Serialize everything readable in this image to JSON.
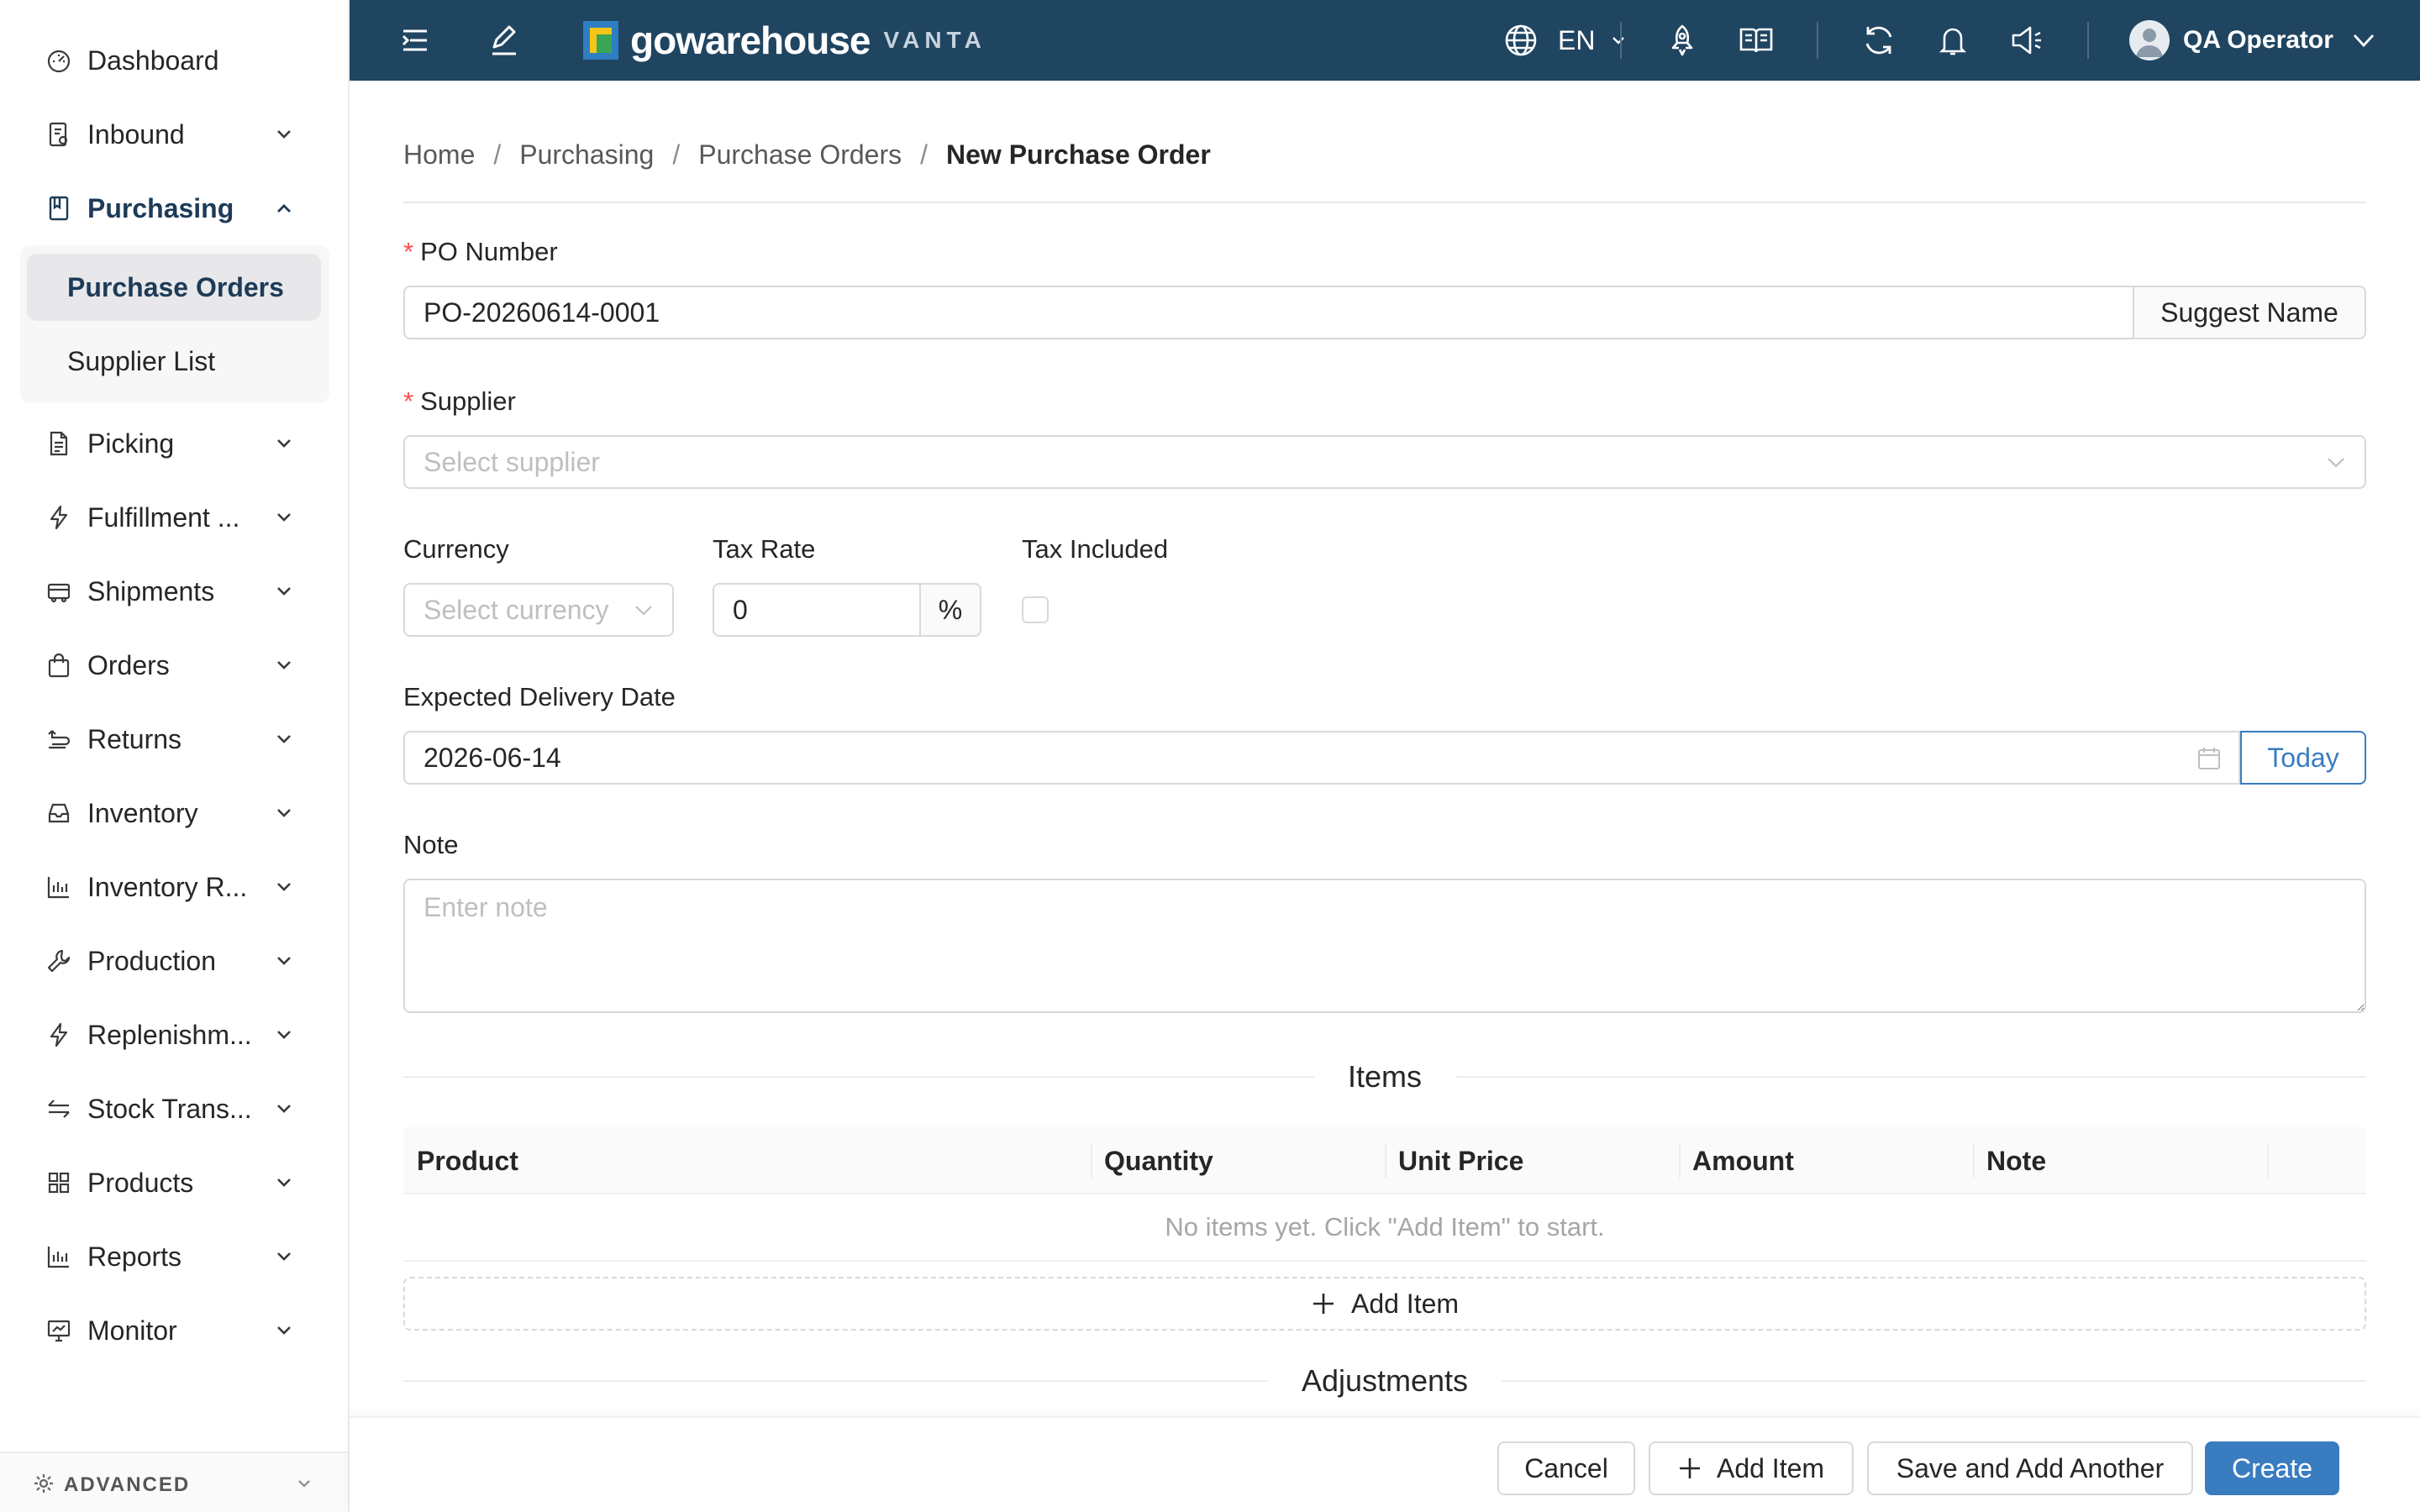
{
  "sidebar": {
    "items": [
      {
        "label": "Dashboard",
        "icon": "dashboard-icon"
      },
      {
        "label": "Inbound",
        "icon": "inbound-icon"
      },
      {
        "label": "Purchasing",
        "icon": "purchasing-icon"
      },
      {
        "label": "Picking",
        "icon": "picking-icon"
      },
      {
        "label": "Fulfillment ...",
        "icon": "fulfillment-icon"
      },
      {
        "label": "Shipments",
        "icon": "shipments-icon"
      },
      {
        "label": "Orders",
        "icon": "orders-icon"
      },
      {
        "label": "Returns",
        "icon": "returns-icon"
      },
      {
        "label": "Inventory",
        "icon": "inventory-icon"
      },
      {
        "label": "Inventory R...",
        "icon": "inventory-reports-icon"
      },
      {
        "label": "Production",
        "icon": "production-icon"
      },
      {
        "label": "Replenishm...",
        "icon": "replenishment-icon"
      },
      {
        "label": "Stock Trans...",
        "icon": "stock-transfer-icon"
      },
      {
        "label": "Products",
        "icon": "products-icon"
      },
      {
        "label": "Reports",
        "icon": "reports-icon"
      },
      {
        "label": "Monitor",
        "icon": "monitor-icon"
      }
    ],
    "submenu": [
      {
        "label": "Purchase Orders"
      },
      {
        "label": "Supplier List"
      }
    ],
    "advanced_label": "ADVANCED"
  },
  "header": {
    "logo_text": "gowarehouse",
    "logo_sub": "VANTA",
    "language": "EN",
    "user_name": "QA Operator"
  },
  "breadcrumb": {
    "items": [
      "Home",
      "Purchasing",
      "Purchase Orders"
    ],
    "current": "New Purchase Order",
    "separator": "/"
  },
  "form": {
    "po_number": {
      "label": "PO Number",
      "value": "PO-20260614-0001",
      "suggest_label": "Suggest Name"
    },
    "supplier": {
      "label": "Supplier",
      "placeholder": "Select supplier"
    },
    "currency": {
      "label": "Currency",
      "placeholder": "Select currency"
    },
    "tax_rate": {
      "label": "Tax Rate",
      "value": "0",
      "suffix": "%"
    },
    "tax_included": {
      "label": "Tax Included",
      "checked": false
    },
    "expected_delivery": {
      "label": "Expected Delivery Date",
      "value": "2026-06-14",
      "today_label": "Today"
    },
    "note": {
      "label": "Note",
      "placeholder": "Enter note"
    }
  },
  "items_section": {
    "title": "Items",
    "columns": [
      "Product",
      "Quantity",
      "Unit Price",
      "Amount",
      "Note"
    ],
    "empty_text": "No items yet. Click \"Add Item\" to start.",
    "add_item_label": "Add Item"
  },
  "adjustments_section": {
    "title": "Adjustments"
  },
  "footer": {
    "cancel": "Cancel",
    "add_item": "Add Item",
    "save_add_another": "Save and Add Another",
    "create": "Create"
  },
  "colors": {
    "header_bg": "#1f4561",
    "primary": "#3a7cc0",
    "active_nav": "#1d3b58",
    "required": "#ff4d4f"
  }
}
